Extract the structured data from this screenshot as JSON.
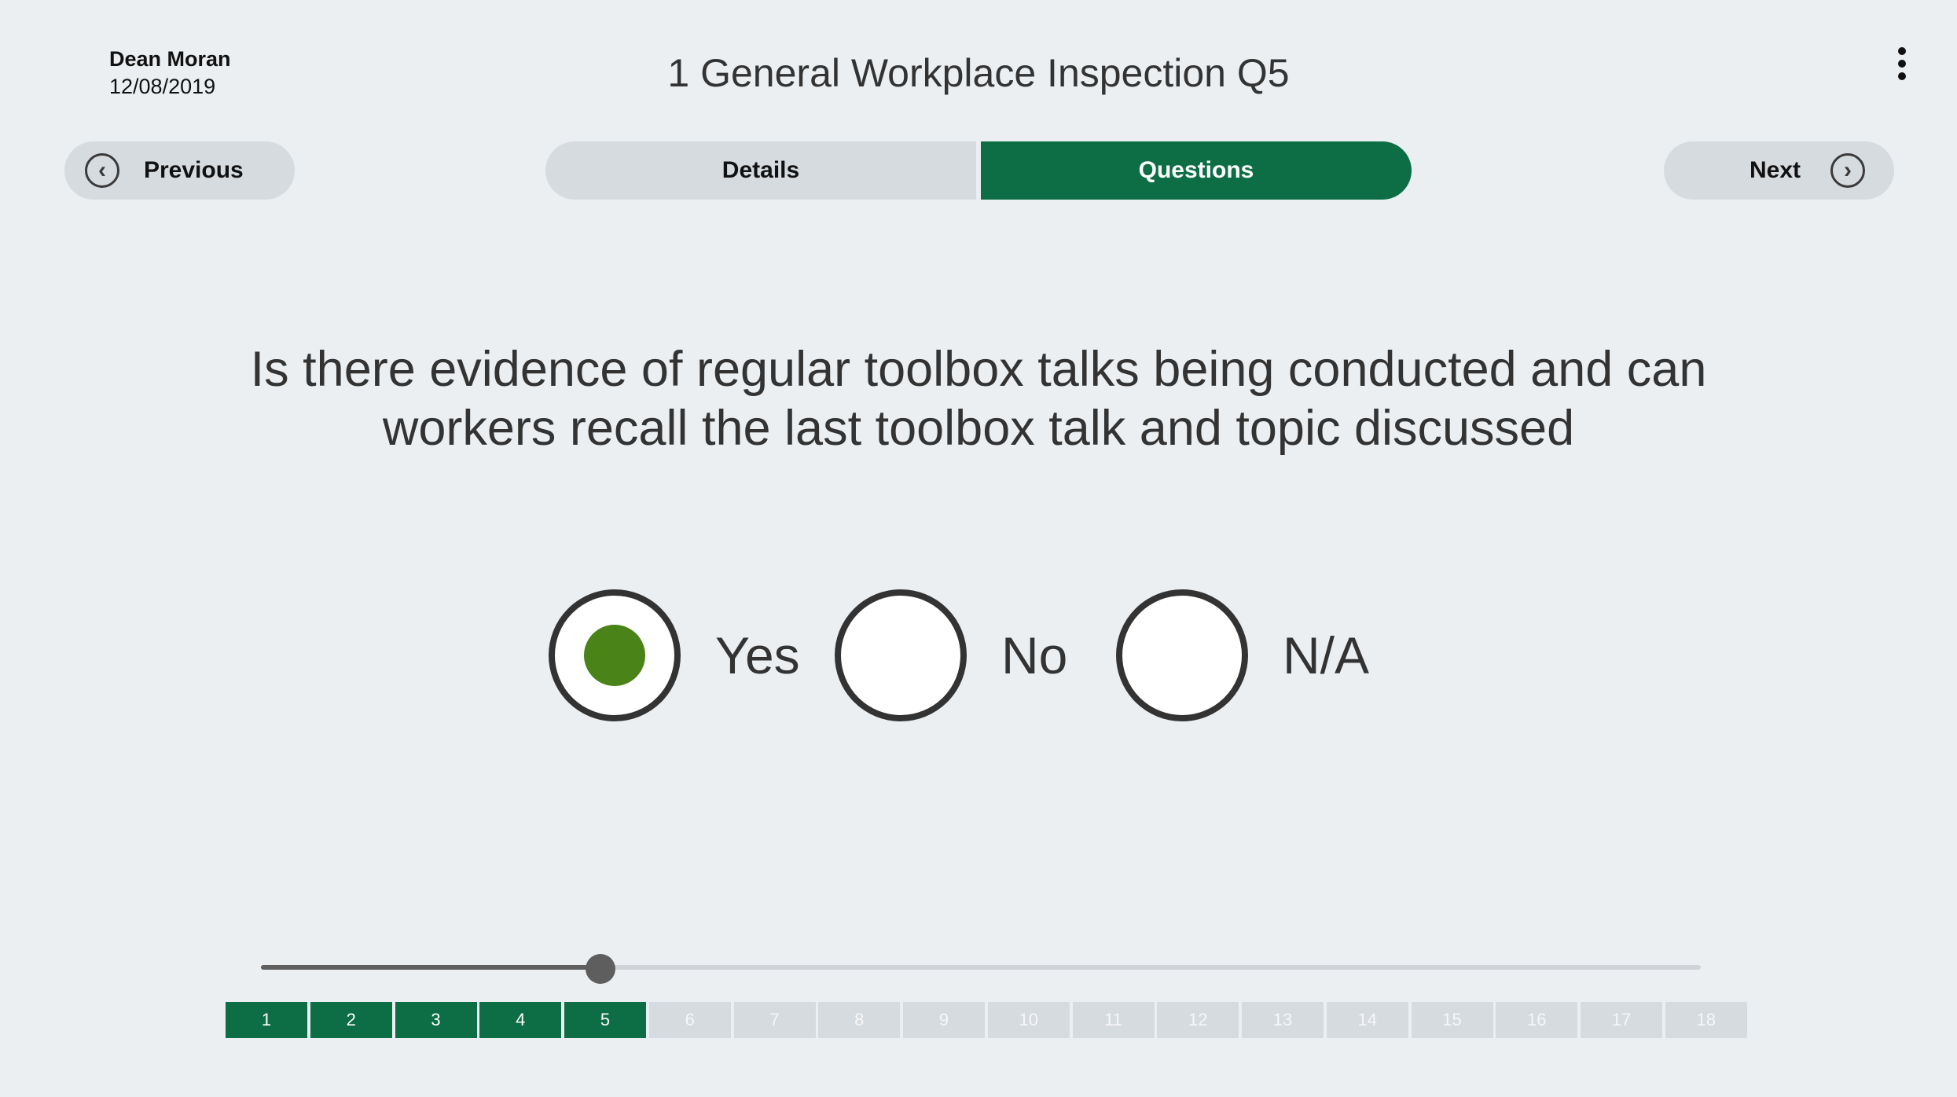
{
  "header": {
    "user_name": "Dean Moran",
    "date": "12/08/2019",
    "title": "1 General Workplace Inspection Q5",
    "menu_icon": "vertical-ellipsis-icon"
  },
  "nav": {
    "previous_label": "Previous",
    "next_label": "Next"
  },
  "tabs": [
    {
      "label": "Details",
      "active": false
    },
    {
      "label": "Questions",
      "active": true
    }
  ],
  "question": {
    "text": "Is there evidence of regular toolbox talks being conducted and can workers recall the last toolbox talk and topic discussed"
  },
  "options": [
    {
      "label": "Yes",
      "selected": true
    },
    {
      "label": "No",
      "selected": false
    },
    {
      "label": "N/A",
      "selected": false
    }
  ],
  "progress": {
    "current": 5,
    "total": 18,
    "steps": [
      "1",
      "2",
      "3",
      "4",
      "5",
      "6",
      "7",
      "8",
      "9",
      "10",
      "11",
      "12",
      "13",
      "14",
      "15",
      "16",
      "17",
      "18"
    ]
  },
  "colors": {
    "accent": "#0d6e45",
    "selected_dot": "#4a8317",
    "background": "#ebeff2",
    "inactive": "#d6dbe0"
  }
}
